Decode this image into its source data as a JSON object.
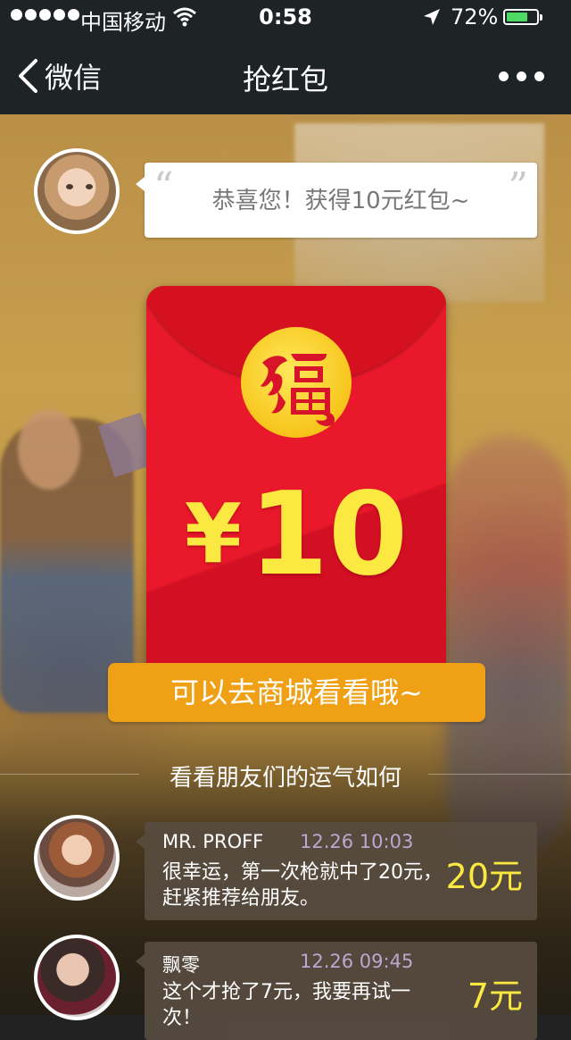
{
  "status_bar": {
    "carrier": "中国移动",
    "time": "0:58",
    "battery_pct": "72%",
    "battery_level": 0.72,
    "signal_icon": "signal-dots-icon",
    "wifi_icon": "wifi-icon",
    "location_icon": "location-arrow-icon",
    "battery_icon": "battery-icon",
    "battery_color": "#4cd964"
  },
  "nav": {
    "back_label": "微信",
    "title": "抢红包",
    "back_icon": "chevron-left-icon",
    "more_icon": "more-dots-icon"
  },
  "greeting": {
    "text": "恭喜您！获得10元红包~"
  },
  "red_packet": {
    "currency": "¥",
    "amount": "10",
    "emblem_icon": "fu-emblem-icon",
    "packet_color": "#e9192b",
    "amount_color": "#fbe941"
  },
  "shop_button": {
    "label": "可以去商城看看哦~",
    "color": "#f0a015"
  },
  "friends": {
    "title": "看看朋友们的运气如何",
    "items": [
      {
        "name": "MR. PROFF",
        "time": "12.26 10:03",
        "message": "很幸运，第一次枪就中了20元，赶紧推荐给朋友。",
        "amount": "20元"
      },
      {
        "name": "飘零",
        "time": "12.26 09:45",
        "message": "这个才抢了7元，我要再试一次！",
        "amount": "7元"
      }
    ]
  }
}
